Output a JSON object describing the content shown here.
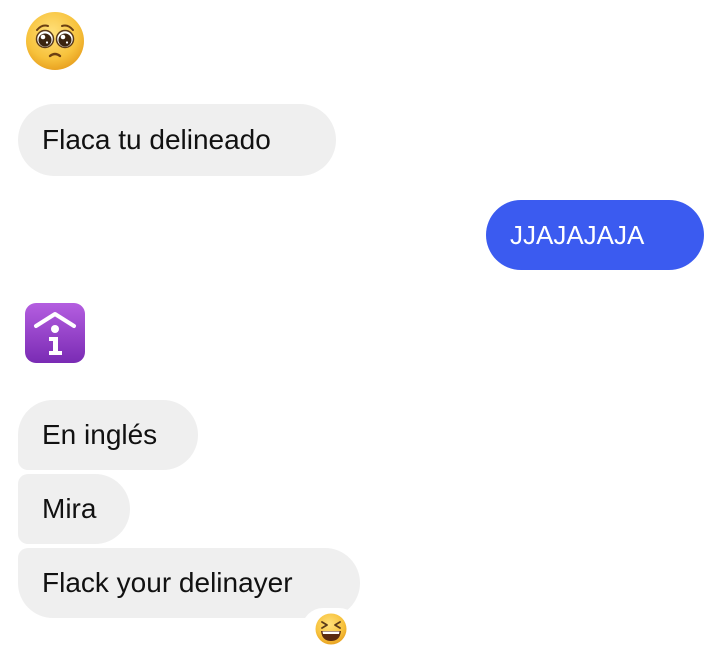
{
  "messages": [
    {
      "type": "emoji",
      "direction": "incoming",
      "icon": "pleading-face-emoji"
    },
    {
      "type": "text",
      "direction": "incoming",
      "text": "Flaca tu delineado"
    },
    {
      "type": "text",
      "direction": "outgoing",
      "text": "JJAJAJAJA"
    },
    {
      "type": "emoji",
      "direction": "incoming",
      "icon": "information-symbol-emoji"
    },
    {
      "type": "text",
      "direction": "incoming",
      "text": "En inglés"
    },
    {
      "type": "text",
      "direction": "incoming",
      "text": "Mira"
    },
    {
      "type": "text",
      "direction": "incoming",
      "text": "Flack your delinayer"
    }
  ],
  "reaction": {
    "icon": "grinning-squinting-face-emoji",
    "on_message": 6
  },
  "colors": {
    "incoming_bubble": "#efefef",
    "incoming_text": "#111111",
    "outgoing_bubble": "#3b5bf0",
    "outgoing_text": "#ffffff",
    "emoji_yellow": "#f7c23c",
    "info_purple": "#8e3dc5"
  }
}
